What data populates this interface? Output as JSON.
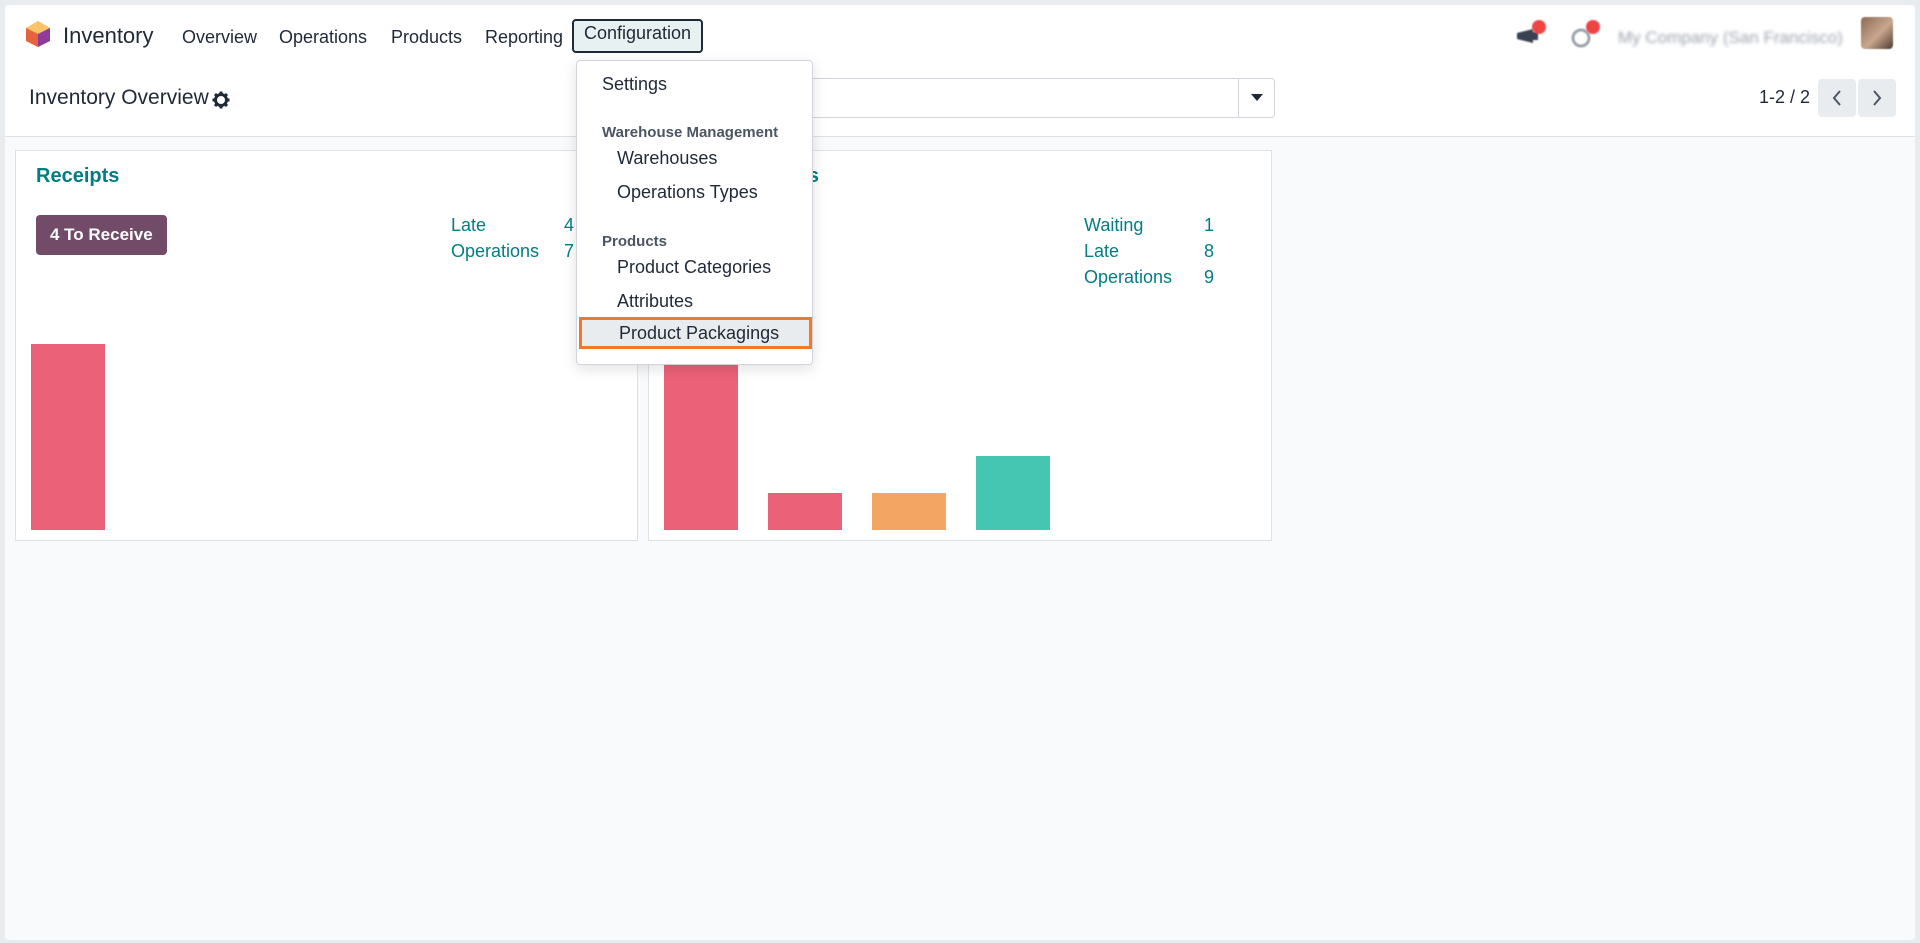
{
  "navbar": {
    "app_name": "Inventory",
    "menu": [
      "Overview",
      "Operations",
      "Products",
      "Reporting",
      "Configuration"
    ],
    "active_menu": "Configuration",
    "company": "My Company (San Francisco)"
  },
  "control_panel": {
    "title": "Inventory Overview",
    "pager": "1-2 / 2"
  },
  "cards": [
    {
      "title": "Receipts",
      "button": "4 To Receive",
      "stats": [
        {
          "label": "Late",
          "value": "4"
        },
        {
          "label": "Operations",
          "value": "7"
        }
      ]
    },
    {
      "title": "Delivery Orders",
      "title_visible": "s",
      "stats": [
        {
          "label": "Waiting",
          "value": "1"
        },
        {
          "label": "Late",
          "value": "8"
        },
        {
          "label": "Operations",
          "value": "9"
        }
      ]
    }
  ],
  "configuration_menu": {
    "settings": "Settings",
    "section_warehouse": "Warehouse Management",
    "warehouses": "Warehouses",
    "operation_types": "Operations Types",
    "section_products": "Products",
    "product_categories": "Product Categories",
    "attributes": "Attributes",
    "product_packagings": "Product Packagings"
  },
  "colors": {
    "brand": "#714b67",
    "accent": "#017e84",
    "highlight_outline": "#f07826",
    "bar_late": "#eb6177",
    "bar_orange": "#f3a563",
    "bar_teal": "#44c6b2"
  }
}
